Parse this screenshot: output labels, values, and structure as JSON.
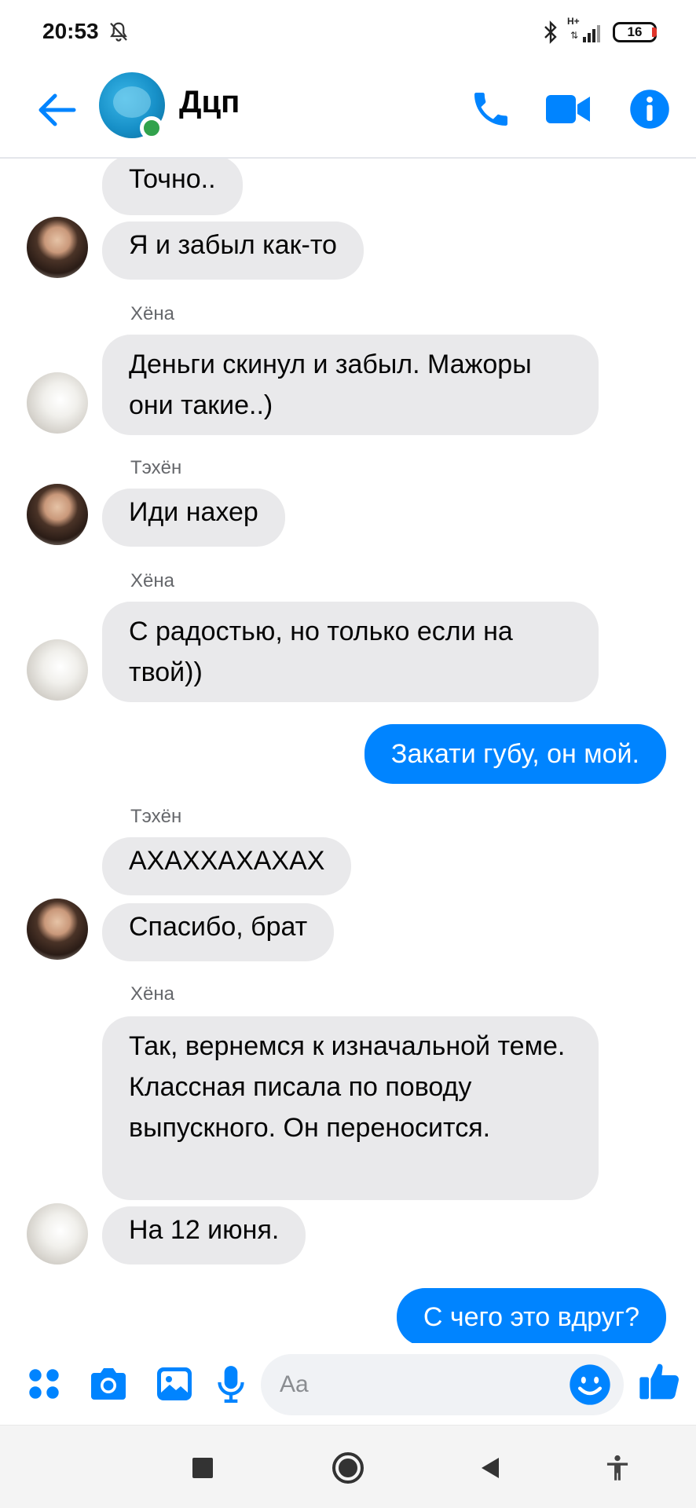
{
  "status": {
    "time": "20:53",
    "network": "H+",
    "battery": "16"
  },
  "header": {
    "title": "Дцп"
  },
  "messages": [
    {
      "text": "Точно.."
    },
    {
      "text": "Я и забыл как-то"
    },
    {
      "sender": "Хёна",
      "text": "Деньги скинул и забыл. Мажоры они такие..)"
    },
    {
      "sender": "Тэхён",
      "text": "Иди нахер"
    },
    {
      "sender": "Хёна",
      "text": "С радостью, но только если на твой))"
    },
    {
      "text": "Закати губу, он мой."
    },
    {
      "sender": "Тэхён",
      "text": "АХАХХАХАХАХ"
    },
    {
      "text": "Спасибо, брат"
    },
    {
      "sender": "Хёна",
      "text": "Так, вернемся к изначальной теме. Классная писала по поводу выпускного. Он переносится."
    },
    {
      "text": "На 12 июня."
    },
    {
      "text": "С чего это вдруг?"
    }
  ],
  "composer": {
    "placeholder": "Aa"
  },
  "colors": {
    "accent": "#0084ff",
    "incoming_bubble": "#e9e9eb",
    "online": "#31a24c"
  }
}
